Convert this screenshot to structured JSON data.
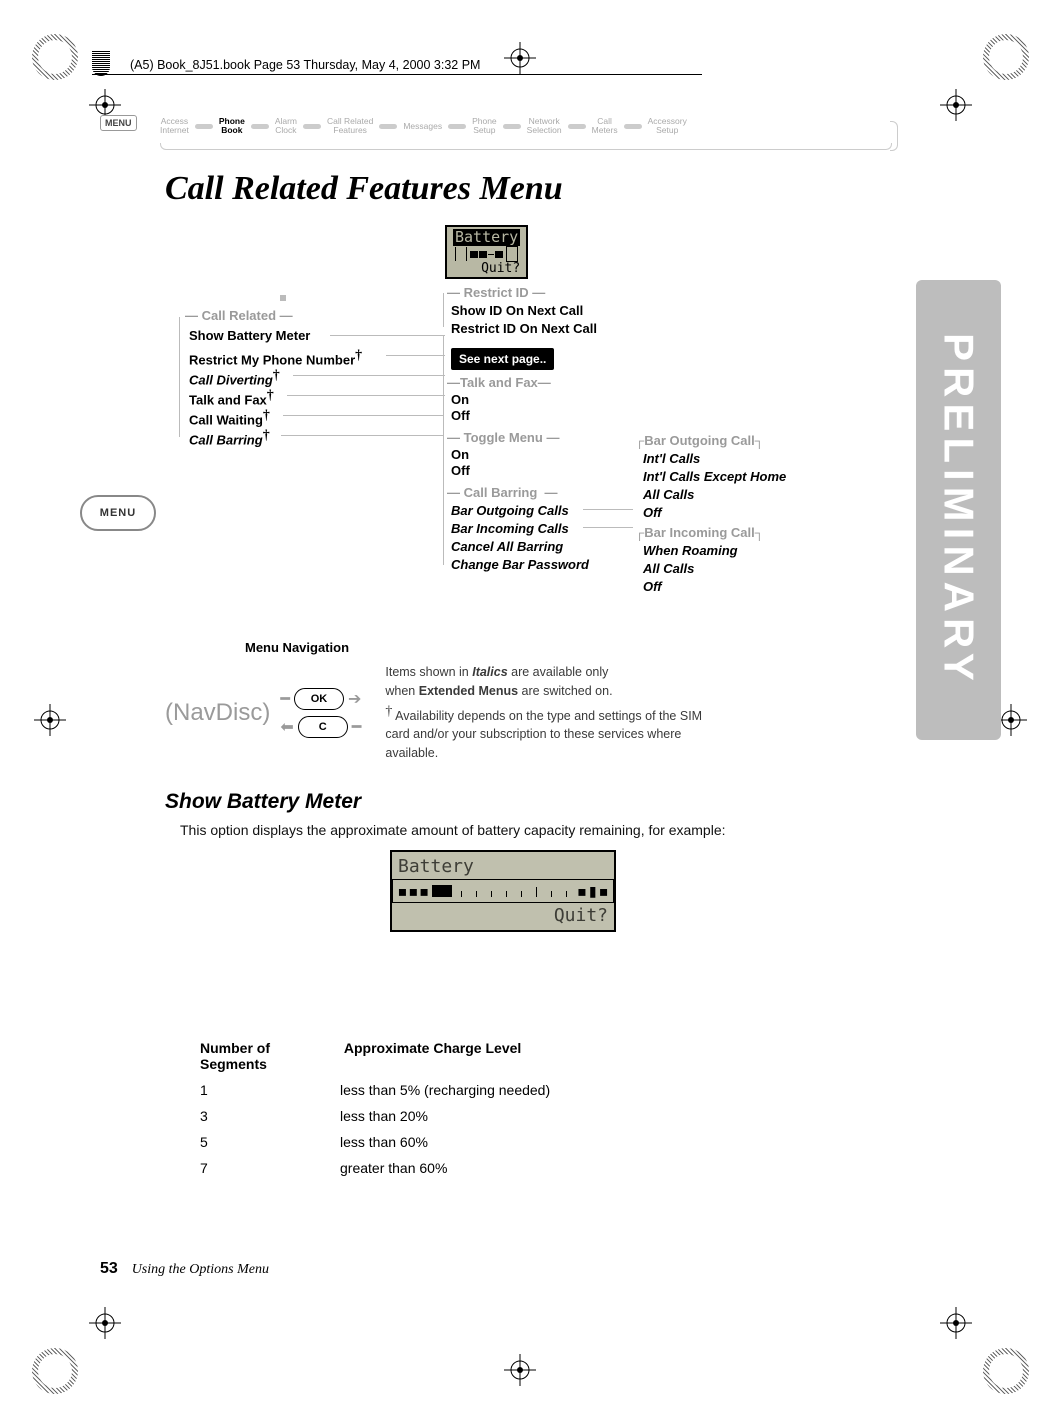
{
  "header": {
    "running": "(A5) Book_8J51.book  Page 53  Thursday, May 4, 2000  3:32 PM"
  },
  "breadcrumb": {
    "tag": "MENU",
    "items": [
      {
        "l1": "Access",
        "l2": "Internet",
        "active": false
      },
      {
        "l1": "Phone",
        "l2": "Book",
        "active": true
      },
      {
        "l1": "Alarm",
        "l2": "Clock",
        "active": false
      },
      {
        "l1": "Call Related",
        "l2": "Features",
        "active": false
      },
      {
        "l1": "Messages",
        "l2": "",
        "active": false
      },
      {
        "l1": "Phone",
        "l2": "Setup",
        "active": false
      },
      {
        "l1": "Network",
        "l2": "Selection",
        "active": false
      },
      {
        "l1": "Call",
        "l2": "Meters",
        "active": false
      },
      {
        "l1": "Accessory",
        "l2": "Setup",
        "active": false
      }
    ]
  },
  "title": "Call Related Features Menu",
  "side_tab": "PRELIMINARY",
  "menu_badge": "MENU",
  "lcd_small": {
    "title": "Battery",
    "action": "Quit?"
  },
  "groups": {
    "call_related": {
      "label": "Call Related",
      "items": [
        "Show Battery Meter",
        "Restrict My Phone Number",
        "Call Diverting",
        "Talk and Fax",
        "Call Waiting",
        "Call Barring"
      ]
    },
    "restrict_id": {
      "label": "Restrict ID",
      "items": [
        "Show ID On Next Call",
        "Restrict ID On Next Call"
      ]
    },
    "see_next": "See next page..",
    "talk_fax": {
      "label": "Talk and Fax",
      "items": [
        "On",
        "Off"
      ]
    },
    "toggle": {
      "label": "Toggle Menu",
      "items": [
        "On",
        "Off"
      ]
    },
    "call_barring": {
      "label": "Call Barring",
      "items": [
        "Bar Outgoing Calls",
        "Bar Incoming Calls",
        "Cancel All Barring",
        "Change Bar Password"
      ]
    },
    "bar_out": {
      "label": "Bar Outgoing Call",
      "items": [
        "Int'l Calls",
        "Int'l Calls Except Home",
        "All Calls",
        "Off"
      ]
    },
    "bar_in": {
      "label": "Bar Incoming Call",
      "items": [
        "When Roaming",
        "All Calls",
        "Off"
      ]
    }
  },
  "nav": {
    "heading": "Menu Navigation",
    "disc": "(NavDisc)",
    "ok": "OK",
    "c": "C",
    "note1a": "Items shown in ",
    "note1b": "Italics",
    "note1c": " are available only",
    "note2a": "when ",
    "note2b": "Extended Menus",
    "note2c": " are switched on.",
    "note3": "Availability depends on the type and settings of the SIM card and/or your subscription to these services where available."
  },
  "section": {
    "heading": "Show Battery Meter",
    "intro": "This option displays the approximate amount of battery capacity remaining, for example:"
  },
  "lcd_big": {
    "title": "Battery",
    "action": "Quit?"
  },
  "table": {
    "h1": "Number of Segments",
    "h2": "Approximate Charge Level",
    "rows": [
      {
        "n": "1",
        "v": "less than 5% (recharging needed)"
      },
      {
        "n": "3",
        "v": "less than 20%"
      },
      {
        "n": "5",
        "v": "less than 60%"
      },
      {
        "n": "7",
        "v": "greater than 60%"
      }
    ]
  },
  "footer": {
    "page": "53",
    "text": "Using the Options Menu"
  }
}
